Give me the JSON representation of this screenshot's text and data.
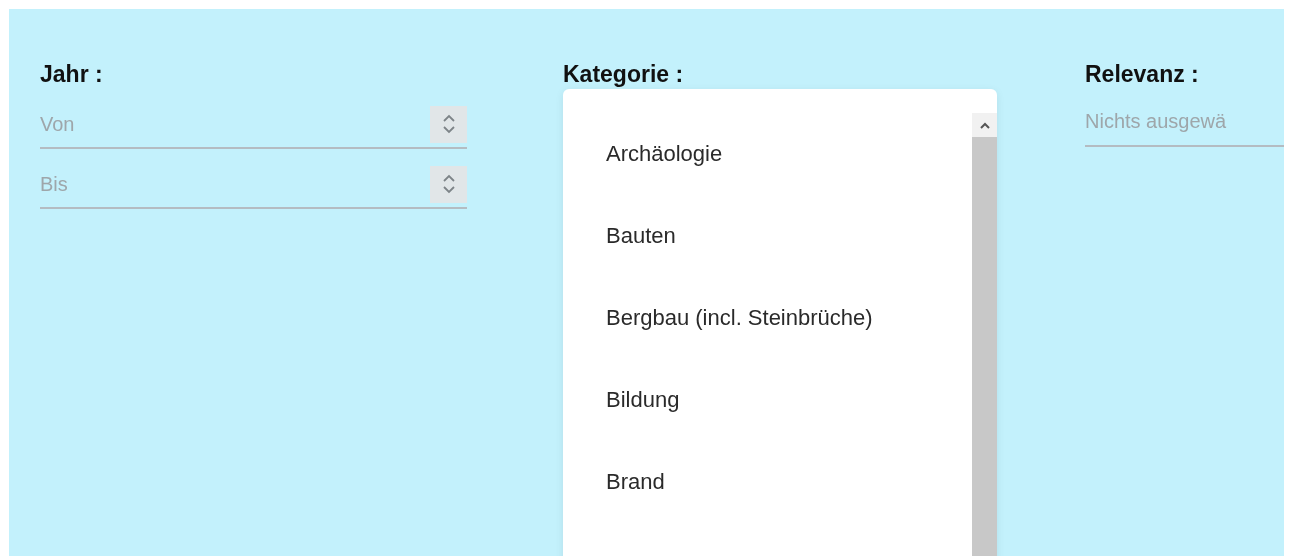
{
  "filters": [
    {
      "kind": "number_range",
      "label": "Jahr :",
      "fields": [
        {
          "placeholder": "Von"
        },
        {
          "placeholder": "Bis"
        }
      ]
    },
    {
      "kind": "select_open",
      "label": "Kategorie :",
      "options": [
        {
          "label": "Archäologie",
          "selected": false
        },
        {
          "label": "Bauten",
          "selected": false
        },
        {
          "label": "Bergbau (incl. Steinbrüche)",
          "selected": false
        },
        {
          "label": "Bildung",
          "selected": false
        },
        {
          "label": "Brand",
          "selected": false
        }
      ]
    },
    {
      "kind": "select",
      "label": "Relevanz :",
      "placeholder": "Nichts ausgewä"
    }
  ]
}
